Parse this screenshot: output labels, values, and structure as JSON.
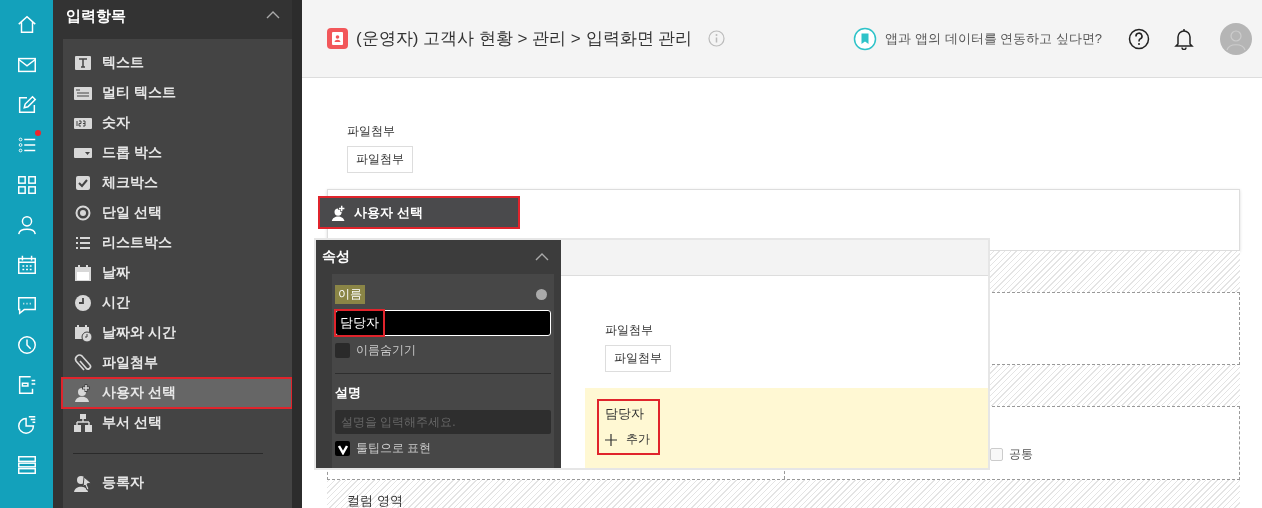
{
  "rail": [
    {
      "badge": false
    },
    {
      "badge": false
    },
    {
      "badge": false
    },
    {
      "badge": true
    },
    {
      "badge": false
    },
    {
      "badge": false
    },
    {
      "badge": false
    },
    {
      "badge": false
    },
    {
      "badge": false
    },
    {
      "badge": false
    },
    {
      "badge": false
    },
    {
      "badge": false
    }
  ],
  "sidebar": {
    "title": "입력항목",
    "items": [
      {
        "label": "텍스트",
        "selected": false
      },
      {
        "label": "멀티 텍스트",
        "selected": false
      },
      {
        "label": "숫자",
        "selected": false
      },
      {
        "label": "드롭 박스",
        "selected": false
      },
      {
        "label": "체크박스",
        "selected": false
      },
      {
        "label": "단일 선택",
        "selected": false
      },
      {
        "label": "리스트박스",
        "selected": false
      },
      {
        "label": "날짜",
        "selected": false
      },
      {
        "label": "시간",
        "selected": false
      },
      {
        "label": "날짜와 시간",
        "selected": false
      },
      {
        "label": "파일첨부",
        "selected": false
      },
      {
        "label": "사용자 선택",
        "selected": true
      },
      {
        "label": "부서 선택",
        "selected": false
      }
    ],
    "system_items": [
      {
        "label": "등록자",
        "selected": false
      }
    ]
  },
  "header": {
    "title": "(운영자) 고객사 현황 > 관리 > 입력화면 관리",
    "promo": "앱과 앱의 데이터를 연동하고 싶다면?"
  },
  "canvas": {
    "file_label": "파일첨부",
    "file_button": "파일첨부",
    "common_checkbox": {
      "label": "공통",
      "checked": false
    },
    "column_area_label": "컬럼 영역"
  },
  "drag_ghost": {
    "label": "사용자 선택"
  },
  "property_panel": {
    "title": "속성",
    "name_badge": "이름",
    "name_value": "담당자",
    "hide_name": {
      "label": "이름숨기기",
      "checked": false
    },
    "description_title": "설명",
    "description_placeholder": "설명을 입력해주세요.",
    "tooltip": {
      "label": "툴팁으로 표현",
      "checked": true
    }
  },
  "preview": {
    "file_label": "파일첨부",
    "file_button": "파일첨부",
    "user_field": {
      "label": "담당자",
      "add_label": "추가"
    }
  }
}
